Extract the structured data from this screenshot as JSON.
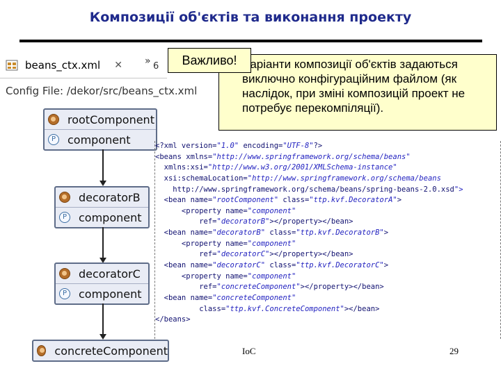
{
  "slide": {
    "title": "Композиції об'єктів та виконання проекту",
    "footer_left": "IoC",
    "footer_right": "29"
  },
  "editor": {
    "tab_label": "beans_ctx.xml",
    "tab_close": "✕",
    "chevron": "»",
    "overflow_count": "6",
    "config_file": "Config File: /dekor/src/beans_ctx.xml"
  },
  "beans": [
    {
      "name": "rootComponent",
      "property": "component",
      "icon": "bean-icon"
    },
    {
      "name": "decoratorB",
      "property": "component",
      "icon": "bean-icon"
    },
    {
      "name": "decoratorC",
      "property": "component",
      "icon": "bean-icon"
    },
    {
      "name": "concreteComponent",
      "property": null,
      "icon": "bean-icon"
    }
  ],
  "property_icon_letter": "P",
  "callout": {
    "badge": "Важливо!",
    "text": "Варіанти композиції об'єктів задаються виключно конфігураційним файлом (як наслідок, при зміні композицій проект не потребує перекомпіляції)."
  },
  "xml": {
    "lines": [
      "<?xml version=\"1.0\" encoding=\"UTF-8\"?>",
      "<beans xmlns=\"http://www.springframework.org/schema/beans\"",
      "  xmlns:xsi=\"http://www.w3.org/2001/XMLSchema-instance\"",
      "  xsi:schemaLocation=\"http://www.springframework.org/schema/beans",
      "    http://www.springframework.org/schema/beans/spring-beans-2.0.xsd\">",
      "  <bean name=\"rootComponent\" class=\"ttp.kvf.DecoratorA\">",
      "      <property name=\"component\"",
      "          ref=\"decoratorB\"></property></bean>",
      "  <bean name=\"decoratorB\" class=\"ttp.kvf.DecoratorB\">",
      "      <property name=\"component\"",
      "          ref=\"decoratorC\"></property></bean>",
      "  <bean name=\"decoratorC\" class=\"ttp.kvf.DecoratorC\">",
      "      <property name=\"component\"",
      "          ref=\"concreteComponent\"></property></bean>",
      "  <bean name=\"concreteComponent\"",
      "          class=\"ttp.kvf.ConcreteComponent\"></bean>",
      "</beans>"
    ]
  },
  "colors": {
    "title": "#1f2a8c",
    "callout_bg": "#ffffcc",
    "bean_bg": "#e9ecf5",
    "bean_border": "#5e6c88",
    "xml_value": "#1f1fbf"
  }
}
